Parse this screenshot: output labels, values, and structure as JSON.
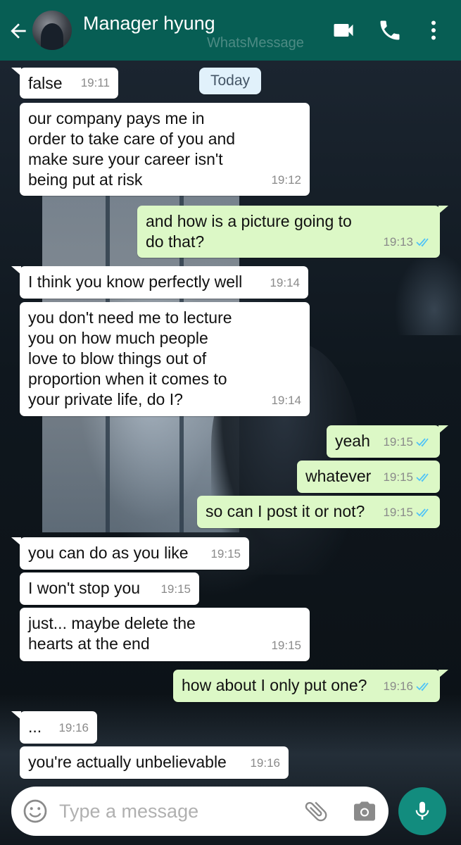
{
  "header": {
    "contact_name": "Manager hyung",
    "watermark": "WhatsMessage",
    "colors": {
      "bar": "#075e54"
    },
    "icons": [
      "back-arrow-icon",
      "avatar",
      "video-call-icon",
      "phone-call-icon",
      "more-vert-icon"
    ]
  },
  "date_chip": "Today",
  "messages": [
    {
      "dir": "in",
      "text": "false",
      "time": "19:11"
    },
    {
      "dir": "in",
      "text": "our company pays me in\norder to take care of you and\nmake sure your career isn't\nbeing put at risk",
      "time": "19:12"
    },
    {
      "dir": "out",
      "text": "and how is a picture going to\ndo that?",
      "time": "19:13",
      "read": true
    },
    {
      "dir": "in",
      "text": "I think you know perfectly well",
      "time": "19:14"
    },
    {
      "dir": "in",
      "text": "you don't need me to lecture\nyou on how much people\nlove to blow things out of\nproportion when it comes to\nyour private life, do I?",
      "time": "19:14"
    },
    {
      "dir": "out",
      "text": "yeah",
      "time": "19:15",
      "read": true
    },
    {
      "dir": "out",
      "text": "whatever",
      "time": "19:15",
      "read": true
    },
    {
      "dir": "out",
      "text": "so can I post it or not?",
      "time": "19:15",
      "read": true
    },
    {
      "dir": "in",
      "text": "you can do as you like",
      "time": "19:15"
    },
    {
      "dir": "in",
      "text": "I won't stop you",
      "time": "19:15"
    },
    {
      "dir": "in",
      "text": "just... maybe delete the\nhearts at the end",
      "time": "19:15"
    },
    {
      "dir": "out",
      "text": "how about I only put one?",
      "time": "19:16",
      "read": true
    },
    {
      "dir": "in",
      "text": "...",
      "time": "19:16"
    },
    {
      "dir": "in",
      "text": "you're actually unbelievable",
      "time": "19:16"
    }
  ],
  "composer": {
    "placeholder": "Type a message",
    "value": "",
    "icons": [
      "emoji-icon",
      "attach-icon",
      "camera-icon",
      "mic-icon"
    ]
  },
  "colors": {
    "incoming_bubble": "#ffffff",
    "outgoing_bubble": "#dcf8c6",
    "read_ticks": "#4fc3f7",
    "mic_button": "#128c7e"
  }
}
